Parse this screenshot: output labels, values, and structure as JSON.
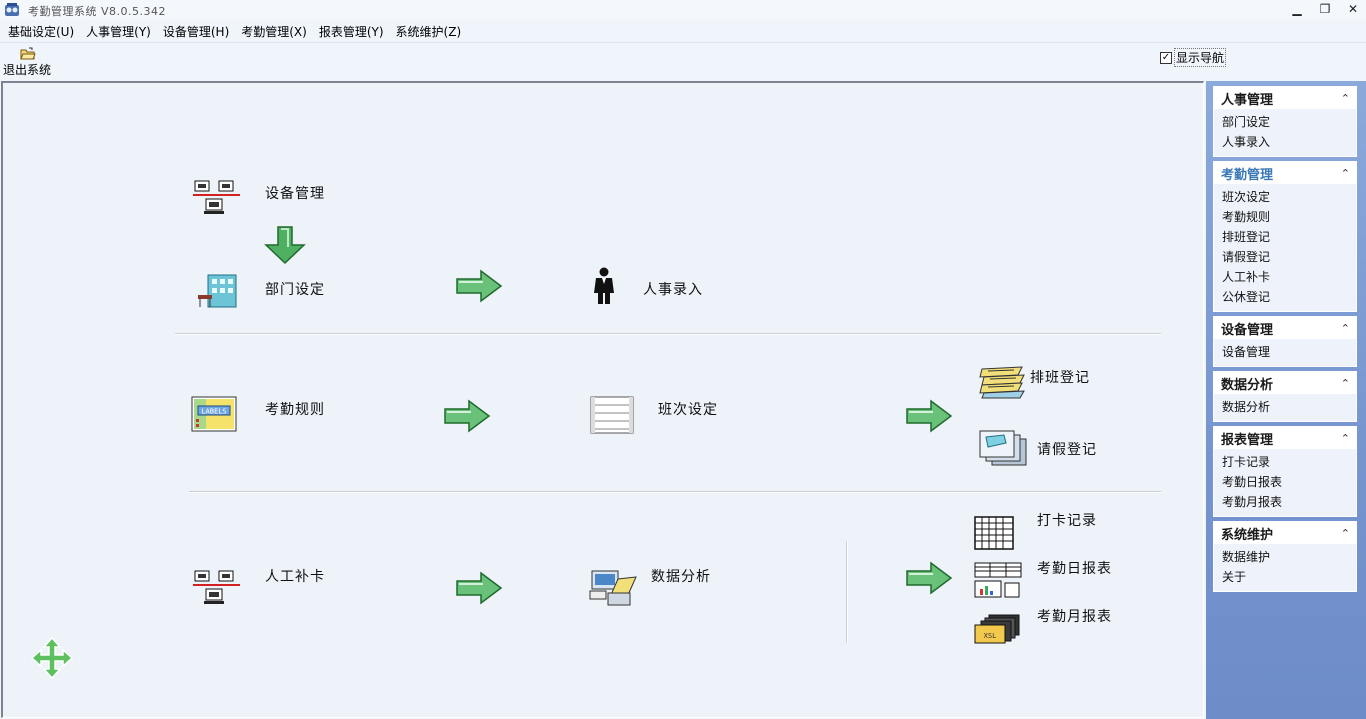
{
  "window": {
    "title": "考勤管理系统 V8.0.5.342",
    "minimize_label": "▁",
    "maximize_label": "❐",
    "close_label": "✕"
  },
  "menu": [
    {
      "label": "基础设定(U)"
    },
    {
      "label": "人事管理(Y)"
    },
    {
      "label": "设备管理(H)"
    },
    {
      "label": "考勤管理(X)"
    },
    {
      "label": "报表管理(Y)"
    },
    {
      "label": "系统维护(Z)"
    }
  ],
  "toolbar": {
    "exit_label": "退出系统",
    "show_nav_label": "显示导航",
    "show_nav_checked": true
  },
  "flow": {
    "row1": {
      "device": "设备管理",
      "dept": "部门设定",
      "staff": "人事录入"
    },
    "row2": {
      "rules": "考勤规则",
      "shift": "班次设定",
      "schedule": "排班登记",
      "leave": "请假登记"
    },
    "row3": {
      "manual": "人工补卡",
      "analysis": "数据分析",
      "punch": "打卡记录",
      "daily": "考勤日报表",
      "monthly": "考勤月报表"
    }
  },
  "sidebar": {
    "groups": [
      {
        "title": "人事管理",
        "items": [
          "部门设定",
          "人事录入"
        ]
      },
      {
        "title": "考勤管理",
        "items": [
          "班次设定",
          "考勤规则",
          "排班登记",
          "请假登记",
          "人工补卡",
          "公休登记"
        ]
      },
      {
        "title": "设备管理",
        "items": [
          "设备管理"
        ]
      },
      {
        "title": "数据分析",
        "items": [
          "数据分析"
        ]
      },
      {
        "title": "报表管理",
        "items": [
          "打卡记录",
          "考勤日报表",
          "考勤月报表"
        ]
      },
      {
        "title": "系统维护",
        "items": [
          "数据维护",
          "关于"
        ]
      }
    ],
    "collapse_glyph": "⌃"
  },
  "colors": {
    "arrow_green": "#2f9c3e",
    "sidebar_blue": "#7b98d2",
    "active_group": "#3b78b6"
  }
}
